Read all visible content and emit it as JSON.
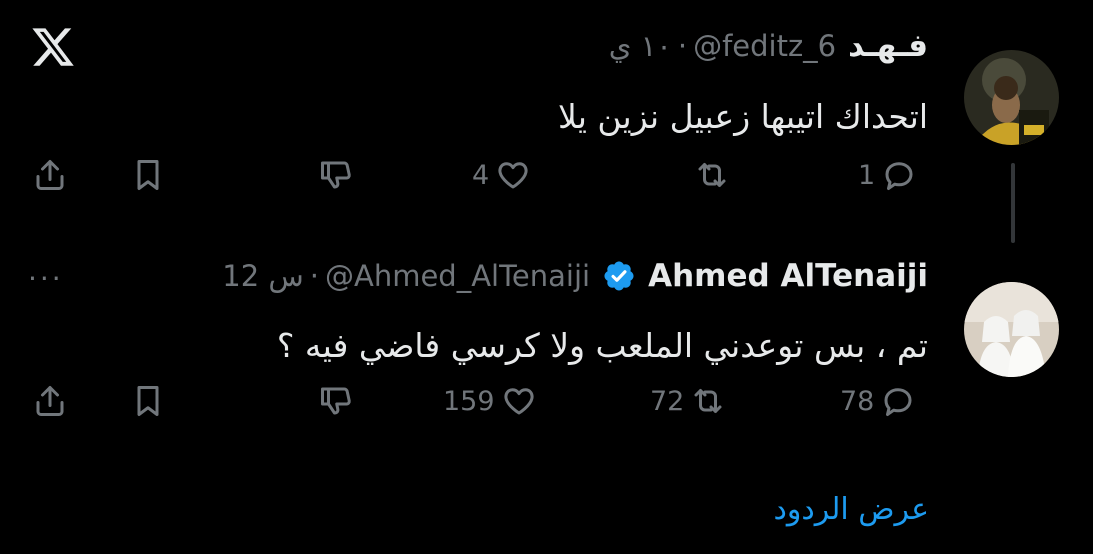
{
  "app": {
    "logo": "x-logo"
  },
  "tweets": [
    {
      "display_name": "فـهـد",
      "handle": "@feditz_6",
      "separator": "·",
      "time": "١٠ ي",
      "text": "اتحداك اتيبها زعبيل نزين يلا",
      "verified": false,
      "show_more": false,
      "actions": {
        "reply": "1",
        "retweet": "",
        "like": "4"
      }
    },
    {
      "display_name": "Ahmed AlTenaiji",
      "handle": "@Ahmed_AlTenaiji",
      "separator": "·",
      "time": "12 س",
      "text": "تم ، بس توعدني الملعب ولا كرسي فاضي فيه ؟",
      "verified": true,
      "verified_color": "#1d9bf0",
      "more_label": "···",
      "actions": {
        "reply": "78",
        "retweet": "72",
        "like": "159"
      }
    }
  ],
  "footer": {
    "show_replies": "عرض الردود"
  },
  "colors": {
    "background": "#000000",
    "primary_text": "#e7e9ea",
    "secondary_text": "#71767b",
    "accent": "#1d9bf0"
  }
}
